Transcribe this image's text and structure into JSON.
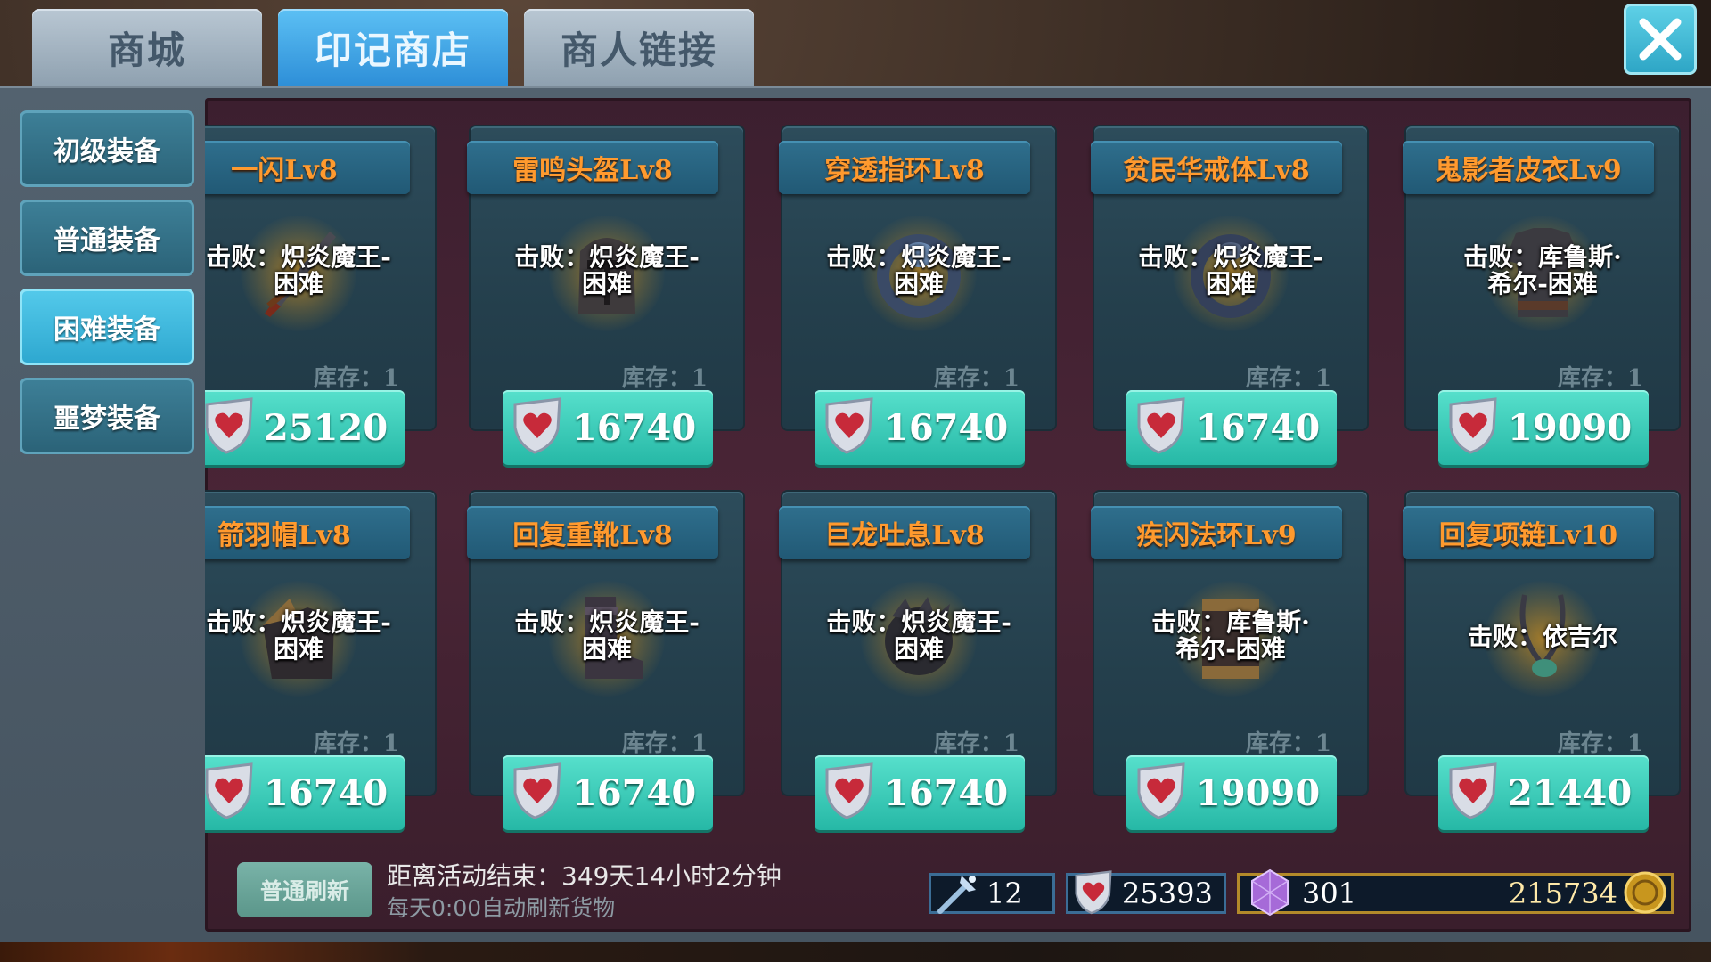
{
  "tabs": [
    {
      "label": "商城",
      "active": false
    },
    {
      "label": "印记商店",
      "active": true
    },
    {
      "label": "商人链接",
      "active": false
    }
  ],
  "close_icon": "close-x-icon",
  "categories": [
    {
      "label": "初级装备",
      "selected": false
    },
    {
      "label": "普通装备",
      "selected": false
    },
    {
      "label": "困难装备",
      "selected": true
    },
    {
      "label": "噩梦装备",
      "selected": false
    }
  ],
  "items": [
    {
      "name": "一闪Lv8",
      "desc_line1": "击败：炽炎魔王-",
      "desc_line2": "困难",
      "stock": "库存：1",
      "price": "25120",
      "icon": "sword-icon"
    },
    {
      "name": "雷鸣头盔Lv8",
      "desc_line1": "击败：炽炎魔王-",
      "desc_line2": "困难",
      "stock": "库存：1",
      "price": "16740",
      "icon": "helmet-icon"
    },
    {
      "name": "穿透指环Lv8",
      "desc_line1": "击败：炽炎魔王-",
      "desc_line2": "困难",
      "stock": "库存：1",
      "price": "16740",
      "icon": "ring-icon"
    },
    {
      "name": "贫民华戒体Lv8",
      "desc_line1": "击败：炽炎魔王-",
      "desc_line2": "困难",
      "stock": "库存：1",
      "price": "16740",
      "icon": "ring-icon"
    },
    {
      "name": "鬼影者皮衣Lv9",
      "desc_line1": "击败：库鲁斯·",
      "desc_line2": "希尔-困难",
      "stock": "库存：1",
      "price": "19090",
      "icon": "armor-icon"
    },
    {
      "name": "箭羽帽Lv8",
      "desc_line1": "击败：炽炎魔王-",
      "desc_line2": "困难",
      "stock": "库存：1",
      "price": "16740",
      "icon": "feather-hat-icon"
    },
    {
      "name": "回复重靴Lv8",
      "desc_line1": "击败：炽炎魔王-",
      "desc_line2": "困难",
      "stock": "库存：1",
      "price": "16740",
      "icon": "boots-icon"
    },
    {
      "name": "巨龙吐息Lv8",
      "desc_line1": "击败：炽炎魔王-",
      "desc_line2": "困难",
      "stock": "库存：1",
      "price": "16740",
      "icon": "dragon-icon"
    },
    {
      "name": "疾闪法环Lv9",
      "desc_line1": "击败：库鲁斯·",
      "desc_line2": "希尔-困难",
      "stock": "库存：1",
      "price": "19090",
      "icon": "bracer-icon"
    },
    {
      "name": "回复项链Lv10",
      "desc_line1": "击败：依吉尔",
      "desc_line2": "",
      "stock": "库存：1",
      "price": "21440",
      "icon": "necklace-icon"
    }
  ],
  "footer": {
    "refresh_label": "普通刷新",
    "countdown": "距离活动结束：349天14小时2分钟",
    "refresh_note": "每天0:00自动刷新货物"
  },
  "resources": {
    "wand": "12",
    "heart_mark": "25393",
    "gem": "301",
    "gold": "215734"
  },
  "colors": {
    "active_tab": "#3ea4e4",
    "title_text": "#ff9a2e",
    "buy_button": "#3ccbb8"
  }
}
